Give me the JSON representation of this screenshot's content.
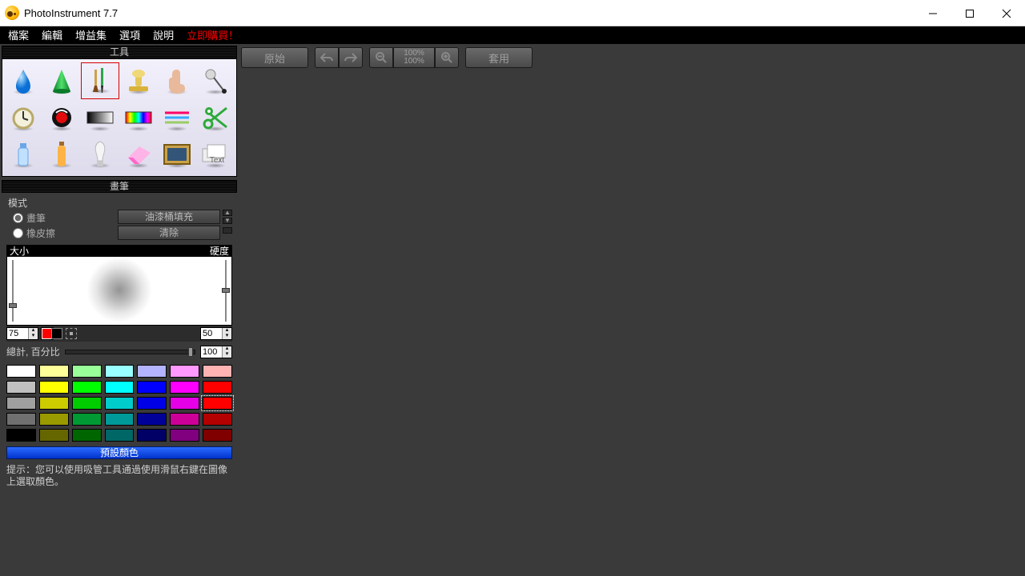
{
  "window": {
    "title": "PhotoInstrument 7.7"
  },
  "menu": {
    "file": "檔案",
    "edit": "編輯",
    "plugins": "增益集",
    "options": "選項",
    "help": "說明",
    "buy": "立即購買！"
  },
  "panels": {
    "tools_title": "工具",
    "brush_title": "畫筆"
  },
  "brush": {
    "mode_label": "模式",
    "radio_brush": "畫筆",
    "radio_eraser": "橡皮擦",
    "btn_fill": "油漆桶填充",
    "btn_clear": "清除",
    "size_label": "大小",
    "hardness_label": "硬度",
    "size_value": "75",
    "hardness_value": "50",
    "opacity_label": "總計, 百分比",
    "opacity_value": "100"
  },
  "palette": {
    "default_btn": "預設顏色",
    "hint": "提示：您可以使用吸管工具通過使用滑鼠右鍵在圖像上選取顏色。",
    "rows": [
      [
        "#ffffff",
        "#ffff99",
        "#99ff99",
        "#99ffff",
        "#b3b3ff",
        "#ff99ff",
        "#ffb3b3"
      ],
      [
        "#c0c0c0",
        "#ffff00",
        "#00ff00",
        "#00ffff",
        "#0000ff",
        "#ff00ff",
        "#ff0000"
      ],
      [
        "#a0a0a0",
        "#cccc00",
        "#00cc00",
        "#00cccc",
        "#0000e6",
        "#e600e6",
        "#ff0000"
      ],
      [
        "#707070",
        "#999900",
        "#009933",
        "#009999",
        "#000099",
        "#cc0099",
        "#b30000"
      ],
      [
        "#000000",
        "#666600",
        "#006600",
        "#006666",
        "#000066",
        "#800080",
        "#800000"
      ]
    ],
    "selected": {
      "row": 2,
      "col": 6
    }
  },
  "toolbar": {
    "original": "原始",
    "apply": "套用",
    "zoom_top": "100%",
    "zoom_bottom": "100%"
  },
  "tools": {
    "items": [
      "drop",
      "cone",
      "brushes",
      "stamp",
      "finger",
      "pin",
      "clock",
      "redeye",
      "gradient",
      "hue",
      "lines",
      "scissors",
      "tube",
      "bottle",
      "bulb",
      "eraser",
      "frame",
      "layers-text"
    ],
    "selected_index": 2
  }
}
